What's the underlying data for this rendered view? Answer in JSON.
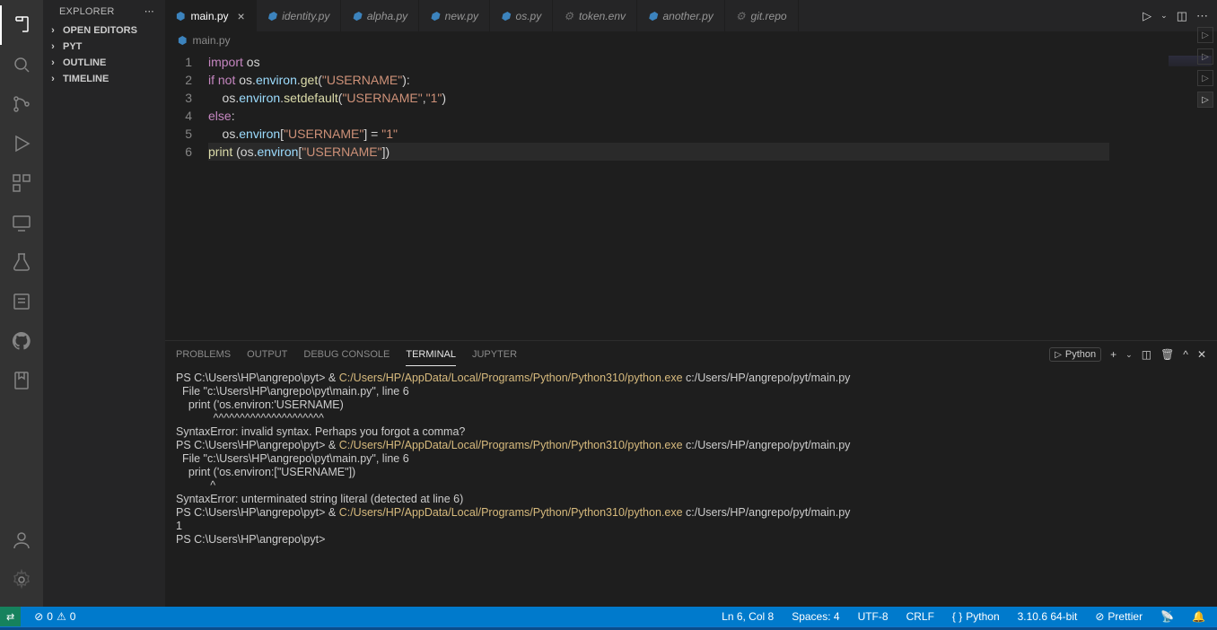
{
  "sidebar": {
    "title": "EXPLORER",
    "sections": [
      {
        "label": "OPEN EDITORS",
        "expanded": false
      },
      {
        "label": "PYT",
        "expanded": false
      },
      {
        "label": "OUTLINE",
        "expanded": false
      },
      {
        "label": "TIMELINE",
        "expanded": false
      }
    ]
  },
  "tabs": [
    {
      "name": "main.py",
      "icon": "python",
      "active": true
    },
    {
      "name": "identity.py",
      "icon": "python"
    },
    {
      "name": "alpha.py",
      "icon": "python"
    },
    {
      "name": "new.py",
      "icon": "python"
    },
    {
      "name": "os.py",
      "icon": "python"
    },
    {
      "name": "token.env",
      "icon": "gear"
    },
    {
      "name": "another.py",
      "icon": "python"
    },
    {
      "name": "git.repo",
      "icon": "gear"
    }
  ],
  "breadcrumb": {
    "file": "main.py"
  },
  "code": {
    "lines": [
      {
        "n": 1,
        "tokens": [
          [
            "kw",
            "import"
          ],
          [
            "plain",
            " os"
          ]
        ]
      },
      {
        "n": 2,
        "tokens": [
          [
            "kw",
            "if"
          ],
          [
            "plain",
            " "
          ],
          [
            "kw",
            "not"
          ],
          [
            "plain",
            " os"
          ],
          [
            "op",
            "."
          ],
          [
            "var",
            "environ"
          ],
          [
            "op",
            "."
          ],
          [
            "fn",
            "get"
          ],
          [
            "op",
            "("
          ],
          [
            "str",
            "\"USERNAME\""
          ],
          [
            "op",
            "):"
          ]
        ]
      },
      {
        "n": 3,
        "tokens": [
          [
            "plain",
            "    os"
          ],
          [
            "op",
            "."
          ],
          [
            "var",
            "environ"
          ],
          [
            "op",
            "."
          ],
          [
            "fn",
            "setdefault"
          ],
          [
            "op",
            "("
          ],
          [
            "str",
            "\"USERNAME\""
          ],
          [
            "op",
            ","
          ],
          [
            "str",
            "\"1\""
          ],
          [
            "op",
            ")"
          ]
        ]
      },
      {
        "n": 4,
        "tokens": [
          [
            "kw",
            "else"
          ],
          [
            "op",
            ":"
          ]
        ]
      },
      {
        "n": 5,
        "tokens": [
          [
            "plain",
            "    os"
          ],
          [
            "op",
            "."
          ],
          [
            "var",
            "environ"
          ],
          [
            "op",
            "["
          ],
          [
            "str",
            "\"USERNAME\""
          ],
          [
            "op",
            "] = "
          ],
          [
            "str",
            "\"1\""
          ]
        ]
      },
      {
        "n": 6,
        "hl": true,
        "tokens": [
          [
            "fn",
            "print"
          ],
          [
            "plain",
            " "
          ],
          [
            "op",
            "("
          ],
          [
            "plain",
            "os"
          ],
          [
            "op",
            "."
          ],
          [
            "var",
            "environ"
          ],
          [
            "op",
            "["
          ],
          [
            "str",
            "\"USERNAME\""
          ],
          [
            "op",
            "])"
          ]
        ]
      }
    ]
  },
  "panel": {
    "tabs": [
      "PROBLEMS",
      "OUTPUT",
      "DEBUG CONSOLE",
      "TERMINAL",
      "JUPYTER"
    ],
    "active": "TERMINAL",
    "shell_label": "Python",
    "terminal": [
      {
        "pre": "PS C:\\Users\\HP\\angrepo\\pyt> & ",
        "yel": "C:/Users/HP/AppData/Local/Programs/Python/Python310/python.exe",
        "post": " c:/Users/HP/angrepo/pyt/main.py"
      },
      {
        "pre": "  File \"c:\\Users\\HP\\angrepo\\pyt\\main.py\", line 6"
      },
      {
        "pre": "    print ('os.environ:'USERNAME)"
      },
      {
        "pre": "            ^^^^^^^^^^^^^^^^^^^^^"
      },
      {
        "pre": "SyntaxError: invalid syntax. Perhaps you forgot a comma?"
      },
      {
        "pre": "PS C:\\Users\\HP\\angrepo\\pyt> & ",
        "yel": "C:/Users/HP/AppData/Local/Programs/Python/Python310/python.exe",
        "post": " c:/Users/HP/angrepo/pyt/main.py"
      },
      {
        "pre": "  File \"c:\\Users\\HP\\angrepo\\pyt\\main.py\", line 6"
      },
      {
        "pre": "    print ('os.environ:[\"USERNAME\"])"
      },
      {
        "pre": "           ^"
      },
      {
        "pre": "SyntaxError: unterminated string literal (detected at line 6)"
      },
      {
        "pre": "PS C:\\Users\\HP\\angrepo\\pyt> & ",
        "yel": "C:/Users/HP/AppData/Local/Programs/Python/Python310/python.exe",
        "post": " c:/Users/HP/angrepo/pyt/main.py"
      },
      {
        "pre": "1"
      },
      {
        "pre": "PS C:\\Users\\HP\\angrepo\\pyt>"
      }
    ]
  },
  "status": {
    "errors": "0",
    "warnings": "0",
    "ln_col": "Ln 6, Col 8",
    "spaces": "Spaces: 4",
    "encoding": "UTF-8",
    "eol": "CRLF",
    "lang": "Python",
    "interpreter": "3.10.6 64-bit",
    "prettier": "Prettier"
  }
}
